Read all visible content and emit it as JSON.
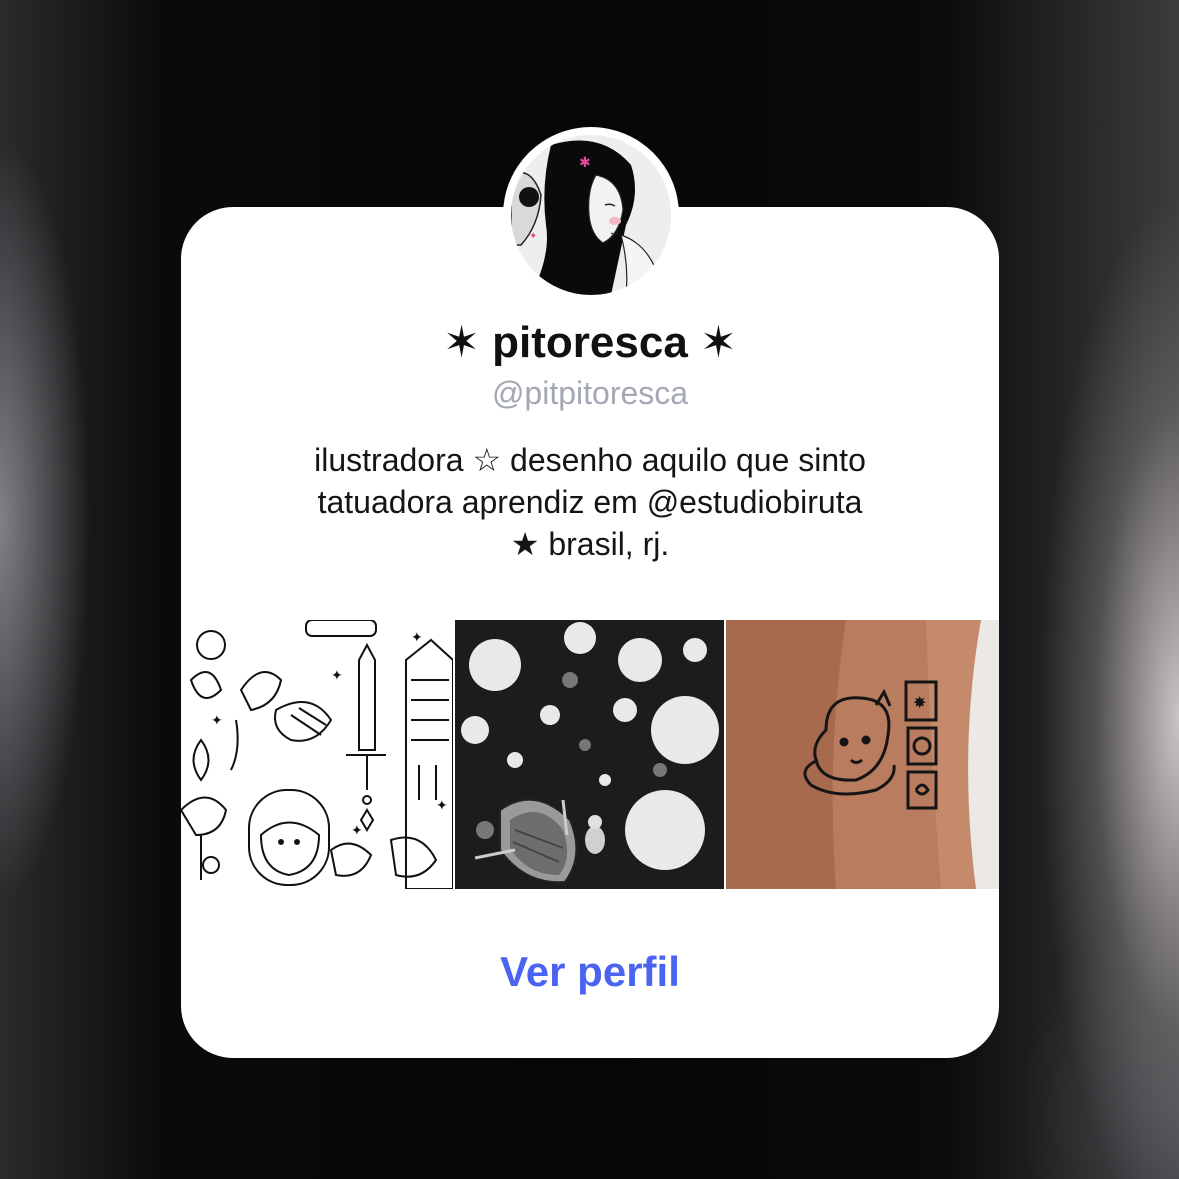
{
  "profile": {
    "display_name": "✶ pitoresca ✶",
    "handle": "@pitpitoresca",
    "bio_lines": [
      "ilustradora ☆ desenho aquilo que sinto",
      "tatuadora aprendiz em @estudiobiruta",
      "★ brasil, rj."
    ]
  },
  "posts": [
    {
      "icon": "flash-sheet-illustration"
    },
    {
      "icon": "boat-lilypads-illustration"
    },
    {
      "icon": "leg-tattoo-photo"
    }
  ],
  "actions": {
    "view_profile_label": "Ver perfil"
  },
  "colors": {
    "accent": "#4a63f0",
    "handle_gray": "#a3a8b3",
    "card_bg": "#ffffff"
  }
}
